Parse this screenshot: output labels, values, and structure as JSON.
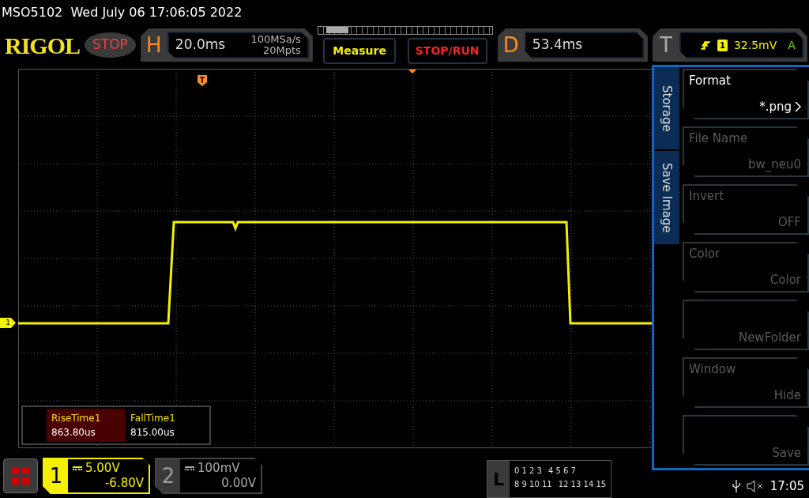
{
  "title_bar": {
    "text": "MSO5102  Wed July 06 17:06:05 2022"
  },
  "header": {
    "logo": "RIGOL",
    "run_state": "STOP",
    "horizontal": {
      "label": "H",
      "timebase": "20.0ms",
      "sample_rate": "100MSa/s",
      "memory_depth": "20Mpts"
    },
    "buttons": [
      {
        "label": "Measure",
        "kind": "measure"
      },
      {
        "label": "STOP/RUN",
        "kind": "run"
      }
    ],
    "delay": {
      "label": "D",
      "value": "53.4ms"
    },
    "trigger": {
      "label": "T",
      "source": "1",
      "level": "32.5mV",
      "mode": "A"
    }
  },
  "plot": {
    "channel_marker": "1"
  },
  "measurements": [
    {
      "name": "RiseTime1",
      "value": "863.80us",
      "selected": true
    },
    {
      "name": "FallTime1",
      "value": "815.00us",
      "selected": false
    }
  ],
  "menu": {
    "tabs": [
      {
        "label": "Storage"
      },
      {
        "label": "Save Image"
      }
    ],
    "items": [
      {
        "label": "Format",
        "value": "*.png",
        "disabled": false,
        "submenu": true
      },
      {
        "label": "File Name",
        "value": "bw_neu0",
        "disabled": true,
        "submenu": false
      },
      {
        "label": "Invert",
        "value": "OFF",
        "disabled": true,
        "submenu": false
      },
      {
        "label": "Color",
        "value": "Color",
        "disabled": true,
        "submenu": false
      },
      {
        "value": "NewFolder",
        "disabled": true,
        "submenu": false
      },
      {
        "label": "Window",
        "value": "Hide",
        "disabled": true,
        "submenu": false
      },
      {
        "value": "Save",
        "disabled": true,
        "submenu": false
      }
    ]
  },
  "channels": [
    {
      "number": "1",
      "scale": "5.00V",
      "offset": "-6.80V",
      "selected": true
    },
    {
      "number": "2",
      "scale": "100mV",
      "offset": "0.00V",
      "selected": false
    }
  ],
  "logic": {
    "label": "L",
    "rows": [
      [
        "0 1 2 3",
        "4 5 6 7"
      ],
      [
        "8 9 10 11",
        "12 13 14 15"
      ]
    ]
  },
  "status": {
    "time": "17:05"
  }
}
